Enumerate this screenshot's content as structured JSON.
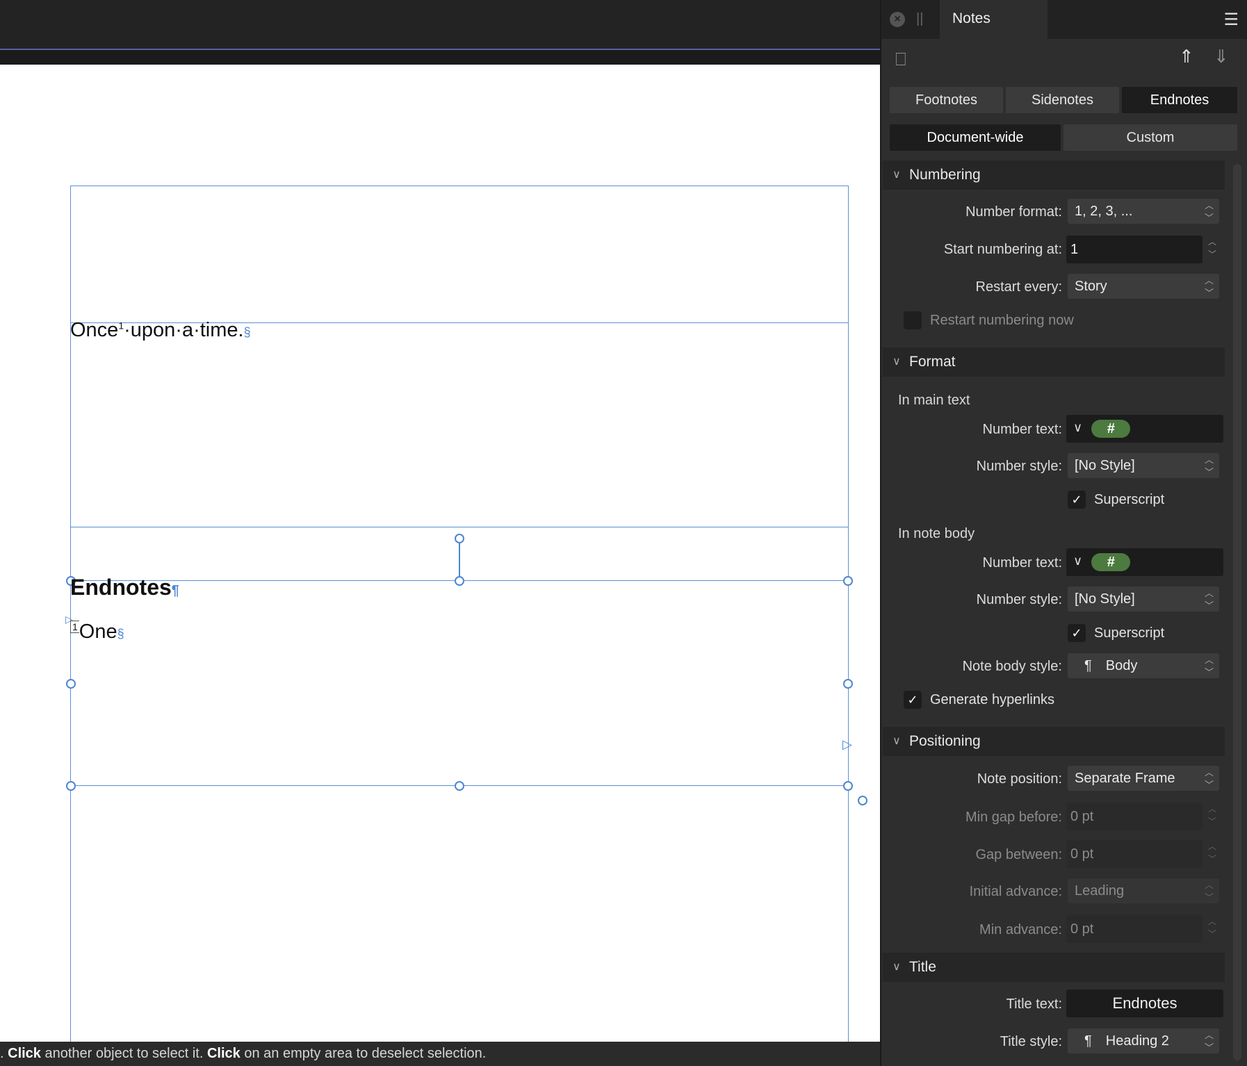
{
  "document": {
    "body_text": "Once",
    "body_sup": "1",
    "body_rest": "·upon·a·time.",
    "section_mark": "§",
    "endnotes_heading": "Endnotes",
    "heading_mark": "¶",
    "note_number": "1",
    "note_text": "One"
  },
  "status": {
    "prefix": ". ",
    "click1": "Click",
    "text1": " another object to select it. ",
    "click2": "Click",
    "text2": " on an empty area to deselect selection."
  },
  "panel": {
    "title": "Notes",
    "type_tabs": [
      "Footnotes",
      "Sidenotes",
      "Endnotes"
    ],
    "active_type_tab": "Endnotes",
    "scope_tabs": [
      "Document-wide",
      "Custom"
    ],
    "active_scope_tab": "Document-wide",
    "numbering": {
      "header": "Numbering",
      "number_format_label": "Number format:",
      "number_format_value": "1, 2, 3, ...",
      "start_label": "Start numbering at:",
      "start_value": "1",
      "restart_label": "Restart every:",
      "restart_value": "Story",
      "restart_now_label": "Restart numbering now"
    },
    "format": {
      "header": "Format",
      "main_text_label": "In main text",
      "main_number_text_label": "Number text:",
      "main_number_token": "#",
      "main_number_style_label": "Number style:",
      "main_number_style_value": "[No Style]",
      "main_superscript_label": "Superscript",
      "note_body_label": "In note body",
      "body_number_text_label": "Number text:",
      "body_number_token": "#",
      "body_number_style_label": "Number style:",
      "body_number_style_value": "[No Style]",
      "body_superscript_label": "Superscript",
      "note_body_style_label": "Note body style:",
      "note_body_style_value": "Body",
      "generate_hyperlinks_label": "Generate hyperlinks"
    },
    "positioning": {
      "header": "Positioning",
      "note_position_label": "Note position:",
      "note_position_value": "Separate Frame",
      "min_gap_label": "Min gap before:",
      "min_gap_value": "0 pt",
      "gap_between_label": "Gap between:",
      "gap_between_value": "0 pt",
      "initial_advance_label": "Initial advance:",
      "initial_advance_value": "Leading",
      "min_advance_label": "Min advance:",
      "min_advance_value": "0 pt"
    },
    "title_section": {
      "header": "Title",
      "title_text_label": "Title text:",
      "title_text_value": "Endnotes",
      "title_style_label": "Title style:",
      "title_style_value": "Heading 2"
    },
    "paragraph_glyph": "¶"
  }
}
